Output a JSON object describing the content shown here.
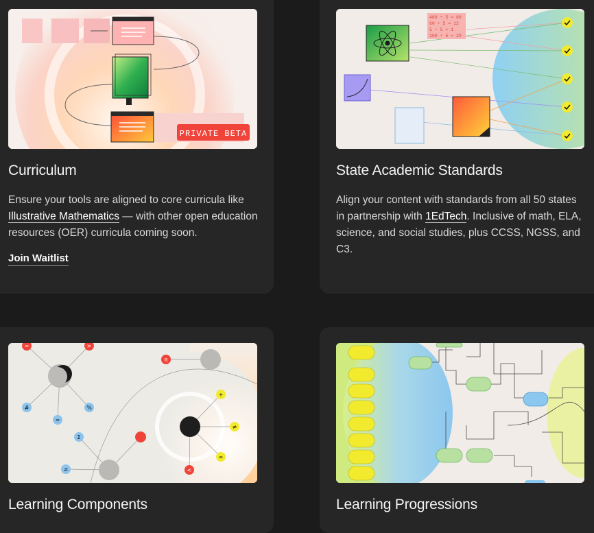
{
  "cards": [
    {
      "title": "Curriculum",
      "badge": "PRIVATE BETA",
      "desc_before": "Ensure your tools are aligned to core curricula like ",
      "desc_link": "Illustrative Mathematics",
      "desc_after": " — with other open education resources (OER) curricula coming soon.",
      "action": "Join Waitlist"
    },
    {
      "title": "State Academic Standards",
      "equations": [
        "480 ÷ 5 = 80",
        "60 ÷ 5 = 12",
        "5 ÷ 5 = 1",
        "100 ÷ 5 = 20"
      ],
      "desc_before": "Align your content with standards from all 50 states in partnership with ",
      "desc_link": "1EdTech",
      "desc_after": ". Inclusive of math, ELA, science, and social studies, plus CCSS, NGSS, and C3."
    },
    {
      "title": "Learning Components",
      "symbols": [
        "=",
        ">",
        "#",
        "%",
        "=",
        "Σ",
        "≠",
        "π",
        "+",
        "≠",
        "∞",
        "<"
      ]
    },
    {
      "title": "Learning Progressions"
    }
  ],
  "colors": {
    "page_bg": "#1b1b1b",
    "card_bg": "#262626",
    "badge_red": "#f0443a",
    "check_yellow": "#f2ea2c"
  }
}
